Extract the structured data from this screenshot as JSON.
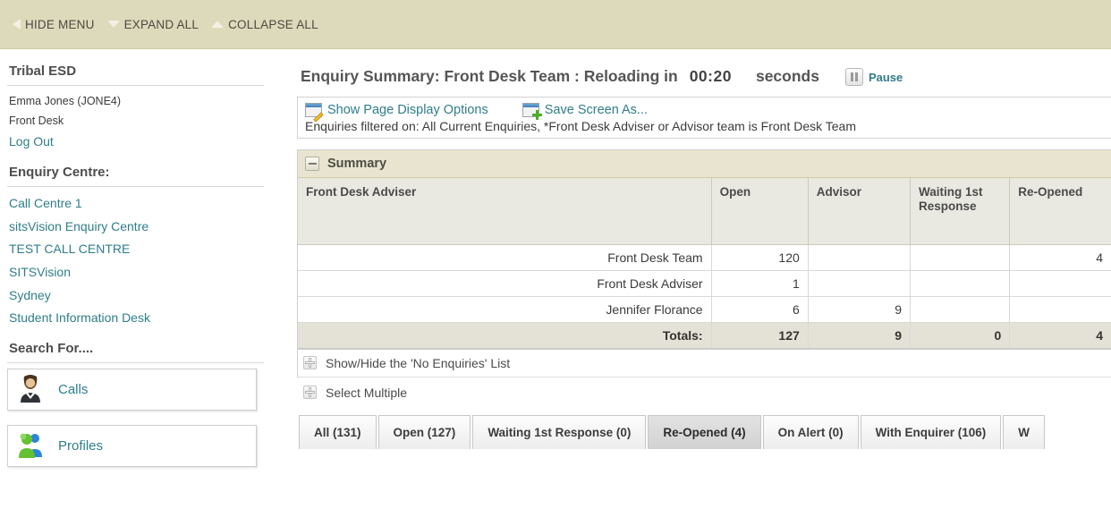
{
  "topbar": {
    "items": [
      {
        "label": "HIDE MENU",
        "icon": "triangle-left-icon"
      },
      {
        "label": "EXPAND ALL",
        "icon": "triangle-down-icon"
      },
      {
        "label": "COLLAPSE ALL",
        "icon": "triangle-up-icon"
      }
    ]
  },
  "sidebar": {
    "app_name": "Tribal ESD",
    "user_name": "Emma Jones (JONE4)",
    "user_team": "Front Desk",
    "log_out": "Log Out",
    "enquiry_centre_heading": "Enquiry Centre:",
    "centres": [
      "Call Centre 1",
      "sitsVision Enquiry Centre",
      "TEST CALL CENTRE",
      "SITSVision",
      "Sydney",
      "Student Information Desk"
    ],
    "search_heading": "Search For....",
    "search_buttons": [
      {
        "label": "Calls",
        "icon": "person-suit-icon"
      },
      {
        "label": "Profiles",
        "icon": "two-people-icon"
      }
    ]
  },
  "main": {
    "title_prefix": "Enquiry Summary: Front Desk Team : Reloading in",
    "countdown": "00:20",
    "seconds_label": "seconds",
    "pause_label": "Pause",
    "options": {
      "show_page_display_options": "Show Page Display Options",
      "save_screen_as": "Save Screen As...",
      "filter_text": "Enquiries filtered on: All Current Enquiries, *Front Desk Adviser or Advisor team is Front Desk Team"
    },
    "panel_title": "Summary",
    "table": {
      "columns": [
        "Front Desk Adviser",
        "Open",
        "Advisor",
        "Waiting 1st Response",
        "Re-Opened"
      ],
      "rows": [
        {
          "name": "Front Desk Team",
          "open": "120",
          "advisor": "",
          "waiting": "",
          "reopened": "4",
          "reopened_highlight": true
        },
        {
          "name": "Front Desk Adviser",
          "open": "1",
          "advisor": "",
          "waiting": "",
          "reopened": "",
          "reopened_highlight": false
        },
        {
          "name": "Jennifer Florance",
          "open": "6",
          "advisor": "9",
          "waiting": "",
          "reopened": "",
          "reopened_highlight": false
        }
      ],
      "totals": {
        "label": "Totals:",
        "open": "127",
        "advisor": "9",
        "waiting": "0",
        "reopened": "4"
      }
    },
    "show_hide_no_enquiries": "Show/Hide the 'No Enquiries' List",
    "select_multiple": "Select Multiple",
    "tabs": [
      {
        "label": "All (131)",
        "active": false
      },
      {
        "label": "Open (127)",
        "active": false
      },
      {
        "label": "Waiting 1st Response (0)",
        "active": false
      },
      {
        "label": "Re-Opened (4)",
        "active": true
      },
      {
        "label": "On Alert (0)",
        "active": false
      },
      {
        "label": "With Enquirer (106)",
        "active": false
      },
      {
        "label": "W",
        "active": false
      }
    ]
  },
  "colors": {
    "topbar_bg": "#ddd9bb",
    "link": "#2f7d8a",
    "panel_head_bg": "#e8e4cf",
    "highlight_green": "#3bf23b"
  }
}
